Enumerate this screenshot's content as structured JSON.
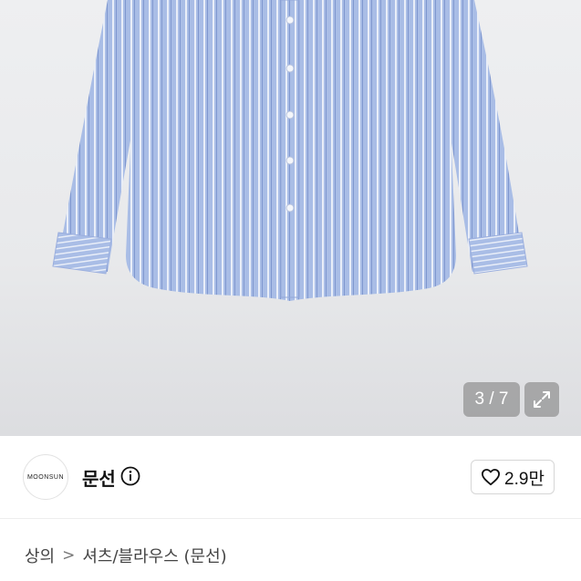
{
  "gallery": {
    "counter_text": "3 / 7",
    "expand_icon": "expand-icon"
  },
  "seller": {
    "avatar_text": "MOONSUN",
    "name": "문선",
    "info_icon": "info-icon"
  },
  "like": {
    "icon": "heart-outline-icon",
    "count": "2.9만"
  },
  "breadcrumb": {
    "items": [
      "상의",
      "셔츠/블라우스 (문선)"
    ],
    "separator": ">"
  },
  "colors": {
    "shirt": "#a9bde6",
    "stripe": "#ffffff",
    "overlay": "#787878"
  }
}
